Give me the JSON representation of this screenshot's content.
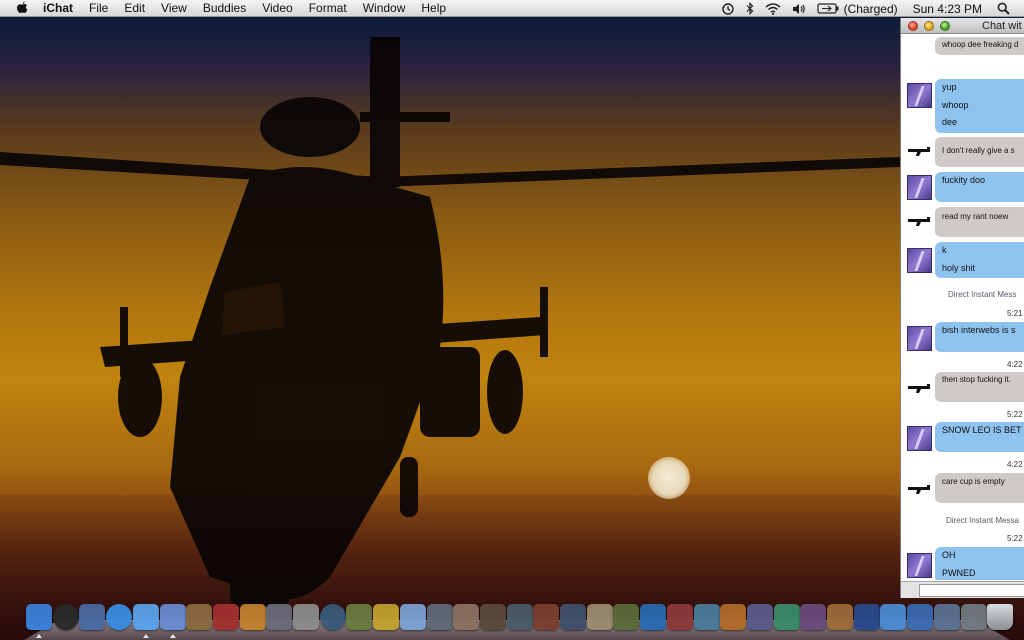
{
  "menubar": {
    "app_name": "iChat",
    "menus": [
      "File",
      "Edit",
      "View",
      "Buddies",
      "Video",
      "Format",
      "Window",
      "Help"
    ],
    "battery_status": "(Charged)",
    "clock": "Sun 4:23 PM",
    "icons": [
      "apple-icon",
      "time-machine-icon",
      "bluetooth-icon",
      "wifi-icon",
      "volume-icon",
      "battery-icon",
      "spotlight-icon"
    ]
  },
  "chat_window": {
    "title": "Chat wit",
    "messages": [
      {
        "sender": "gun",
        "bubble": "gray",
        "lines": [
          "whoop dee freaking d"
        ]
      },
      {
        "sender": "purple",
        "bubble": "blue",
        "lines": [
          "yup",
          "whoop",
          "dee"
        ]
      },
      {
        "sender": "gun",
        "bubble": "gray",
        "lines": [
          "I don't really give a s"
        ]
      },
      {
        "sender": "purple",
        "bubble": "blue",
        "lines": [
          "fuckity doo"
        ]
      },
      {
        "sender": "gun",
        "bubble": "gray",
        "lines": [
          "read my rant noew"
        ]
      },
      {
        "sender": "purple",
        "bubble": "blue",
        "lines": [
          "k",
          "holy shit"
        ]
      },
      {
        "sender": "purple",
        "bubble": "blue",
        "lines": [
          "bish interwebs is s"
        ]
      },
      {
        "sender": "gun",
        "bubble": "gray",
        "lines": [
          "then stop fucking it."
        ]
      },
      {
        "sender": "purple",
        "bubble": "blue",
        "lines": [
          "SNOW LEO IS BET"
        ]
      },
      {
        "sender": "gun",
        "bubble": "gray",
        "lines": [
          "care cup is empty"
        ]
      },
      {
        "sender": "purple",
        "bubble": "blue",
        "lines": [
          "OH",
          "PWNED"
        ]
      }
    ],
    "notes": [
      "Direct Instant Mess",
      "Direct Instant Messa"
    ],
    "times": [
      "5:21",
      "4:22",
      "5:22",
      "4:22",
      "5:22"
    ],
    "input_value": ""
  },
  "dock": {
    "apps": [
      "Finder",
      "Dashboard",
      "Preview",
      "Safari",
      "iChat",
      "iTunes",
      "iPhoto",
      "iMovie",
      "GarageBand",
      "Photo Booth",
      "System Preferences",
      "Time Machine",
      "Game",
      "Game",
      "Mail",
      "Game",
      "Game",
      "Game",
      "Game",
      "Game",
      "Game",
      "Game",
      "Game",
      "Game",
      "Game",
      "Game",
      "Game",
      "Game",
      "Game",
      "Game",
      "Game",
      "Game",
      "Game",
      "Downloads",
      "Documents",
      "Applications",
      "Trash"
    ],
    "colors": [
      "#3a7fd8",
      "#2a2a2a",
      "#4a6aa0",
      "#3a8ae0",
      "#5aa0e8",
      "#6a8ad0",
      "#8a6a40",
      "#a03030",
      "#c08030",
      "#6a6a7a",
      "#8a8a8a",
      "#3a5a7a",
      "#6a7a40",
      "#c0a030",
      "#7aa0d0",
      "#606878",
      "#8a7060",
      "#5a4a3a",
      "#4a5a6a",
      "#7a4030",
      "#40506a",
      "#9a8a70",
      "#5a6a3a",
      "#2a6ab0",
      "#8a3a3a",
      "#4a7a9a",
      "#b06a2a",
      "#5a5a8a",
      "#3a8a6a",
      "#6a4a7a",
      "#9a6a3a",
      "#2a4a8a",
      "#4a8ad0",
      "#3a6ab0",
      "#5a7090",
      "#707880",
      "#a0a4a8"
    ]
  }
}
